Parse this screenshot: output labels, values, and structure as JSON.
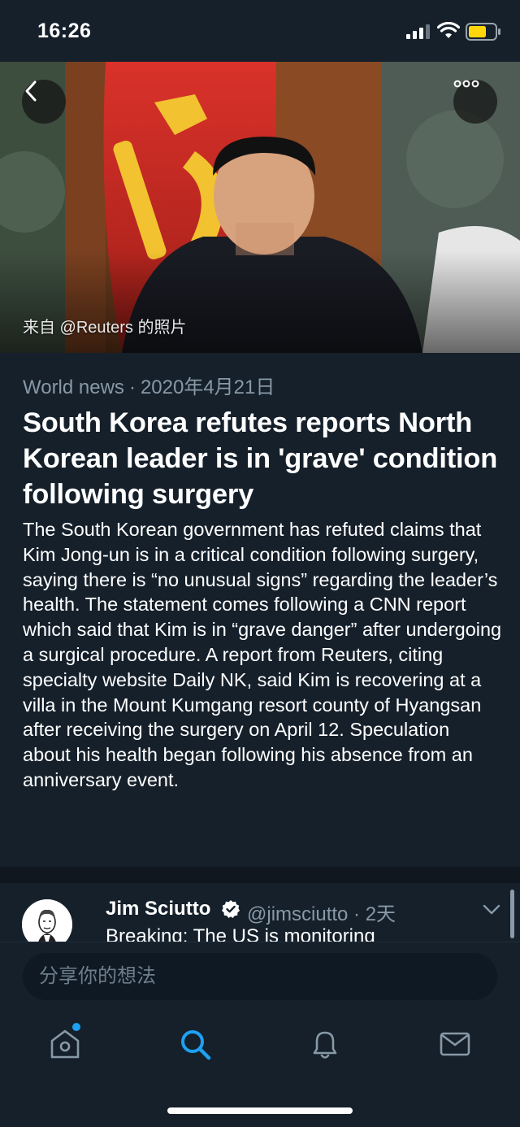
{
  "status_bar": {
    "time": "16:26"
  },
  "hero": {
    "photo_credit": "来自 @Reuters 的照片"
  },
  "article": {
    "category": "World news",
    "separator": "·",
    "date": "2020年4月21日",
    "headline": "South Korea refutes reports North Korean leader is in 'grave' condition following surgery",
    "summary": "The South Korean government has refuted claims that Kim Jong-un is in a critical condition following surgery, saying there is “no unusual signs” regarding the leader’s health. The statement comes following a CNN report which said that Kim is in “grave danger” after undergoing a surgical procedure. A report from Reuters, citing specialty website Daily NK, said Kim is recovering at a villa in the Mount Kumgang resort county of Hyangsan after receiving the surgery on April 12. Speculation about his health began following his absence from an anniversary event."
  },
  "tweet": {
    "name": "Jim Sciutto",
    "handle_time": "@jimsciutto · 2天",
    "text": "Breaking: The US is monitoring"
  },
  "composer": {
    "placeholder": "分享你的想法"
  },
  "tab_bar": {
    "items": [
      "home-icon",
      "search-icon",
      "notifications-icon",
      "messages-icon"
    ],
    "active": "search-icon"
  },
  "colors": {
    "background": "#15202b",
    "accent": "#1da1f2",
    "secondary_text": "#8899a6"
  }
}
